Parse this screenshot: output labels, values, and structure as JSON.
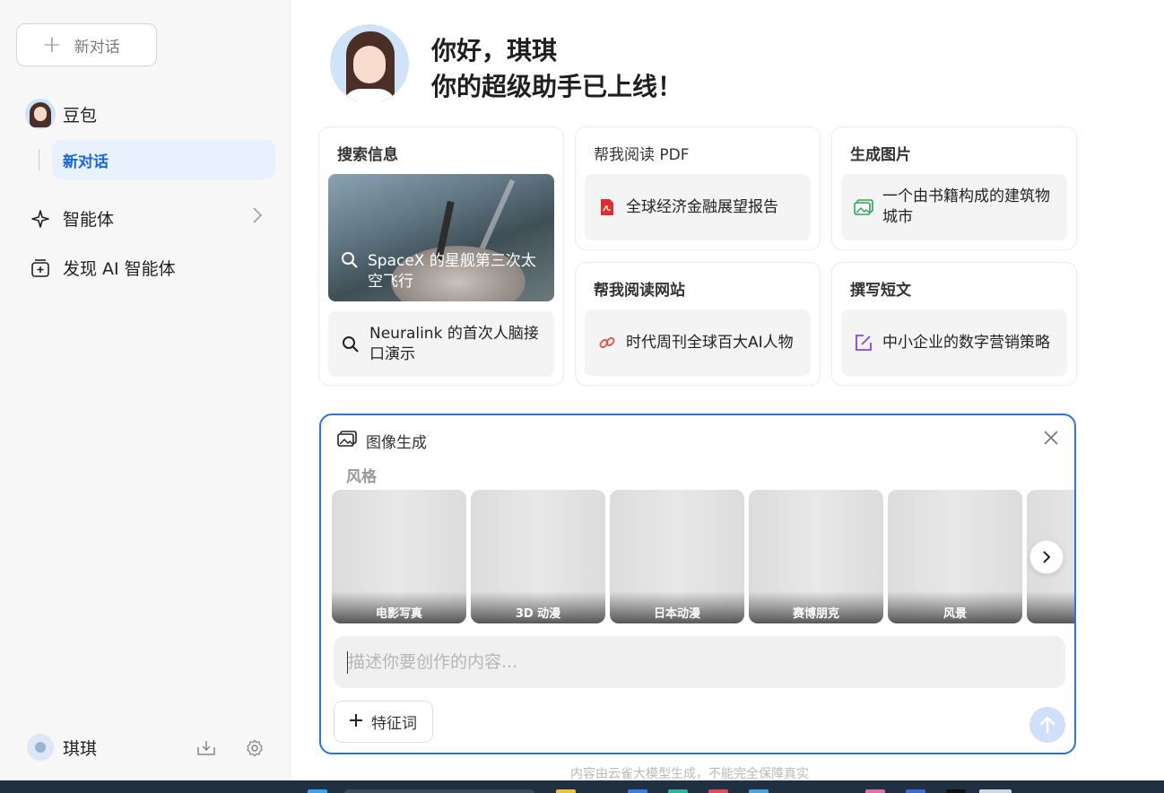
{
  "sidebar": {
    "new_chat_label": "新对话",
    "bot_name": "豆包",
    "active_conversation": "新对话",
    "agents_label": "智能体",
    "discover_label": "发现 AI 智能体",
    "user_name": "琪琪"
  },
  "header": {
    "greeting_line1": "你好，琪琪",
    "greeting_line2": "你的超级助手已上线！"
  },
  "cards": {
    "search": {
      "title": "搜索信息",
      "item1": "SpaceX 的星舰第三次太空飞行",
      "item2": "Neuralink 的首次人脑接口演示"
    },
    "read_pdf": {
      "title": "帮我阅读 PDF",
      "item": "全球经济金融展望报告"
    },
    "gen_image": {
      "title": "生成图片",
      "item": "一个由书籍构成的建筑物城市"
    },
    "read_web": {
      "title": "帮我阅读网站",
      "item": "时代周刊全球百大AI人物"
    },
    "write": {
      "title": "撰写短文",
      "item": "中小企业的数字营销策略"
    }
  },
  "image_gen": {
    "title": "图像生成",
    "style_label": "风格",
    "styles": [
      "电影写真",
      "3D 动漫",
      "日本动漫",
      "赛博朋克",
      "风景",
      ""
    ],
    "prompt_placeholder": "描述你要创作的内容...",
    "feature_button": "特征词"
  },
  "disclaimer": "内容由云雀大模型生成，不能完全保障真实",
  "colors": {
    "accent": "#1565e6",
    "panel_border": "#2a73e8",
    "pdf_red": "#e02e2e",
    "image_green": "#2aa84f",
    "link_red": "#e0524a",
    "edit_purple": "#8a3ff0"
  }
}
